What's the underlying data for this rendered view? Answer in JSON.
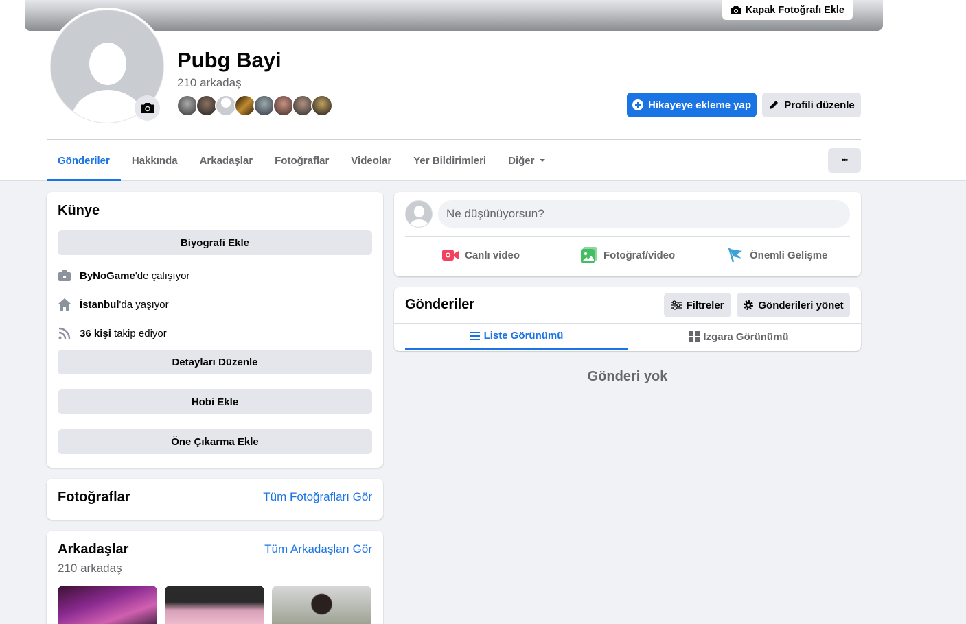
{
  "cover": {
    "add_cover_label": "Kapak Fotoğrafı Ekle"
  },
  "profile": {
    "name": "Pubg Bayi",
    "friends_count": "210 arkadaş"
  },
  "actions": {
    "add_story": "Hikayeye ekleme yap",
    "edit_profile": "Profili düzenle",
    "more": "•••"
  },
  "tabs": [
    {
      "label": "Gönderiler"
    },
    {
      "label": "Hakkında"
    },
    {
      "label": "Arkadaşlar"
    },
    {
      "label": "Fotoğraflar"
    },
    {
      "label": "Videolar"
    },
    {
      "label": "Yer Bildirimleri"
    },
    {
      "label": "Diğer"
    }
  ],
  "intro": {
    "title": "Künye",
    "add_bio": "Biyografi Ekle",
    "work_bold": "ByNoGame",
    "work_rest": "'de çalışıyor",
    "city_bold": "İstanbul",
    "city_rest": "'da yaşıyor",
    "follow_bold": "36 kişi",
    "follow_rest": " takip ediyor",
    "edit_details": "Detayları Düzenle",
    "add_hobby": "Hobi Ekle",
    "add_featured": "Öne Çıkarma Ekle"
  },
  "photos": {
    "title": "Fotoğraflar",
    "see_all": "Tüm Fotoğrafları Gör"
  },
  "friends": {
    "title": "Arkadaşlar",
    "see_all": "Tüm Arkadaşları Gör",
    "count": "210 arkadaş"
  },
  "composer": {
    "placeholder": "Ne düşünüyorsun?",
    "live_video": "Canlı video",
    "photo_video": "Fotoğraf/video",
    "life_event": "Önemli Gelişme"
  },
  "posts": {
    "title": "Gönderiler",
    "filters": "Filtreler",
    "manage": "Gönderileri yönet",
    "list_view": "Liste Görünümü",
    "grid_view": "Izgara Görünümü",
    "empty": "Gönderi yok"
  },
  "colors": {
    "accent": "#1b74e4",
    "live": "#f3425f",
    "photo": "#45bd62",
    "event": "#3ea2d7"
  }
}
